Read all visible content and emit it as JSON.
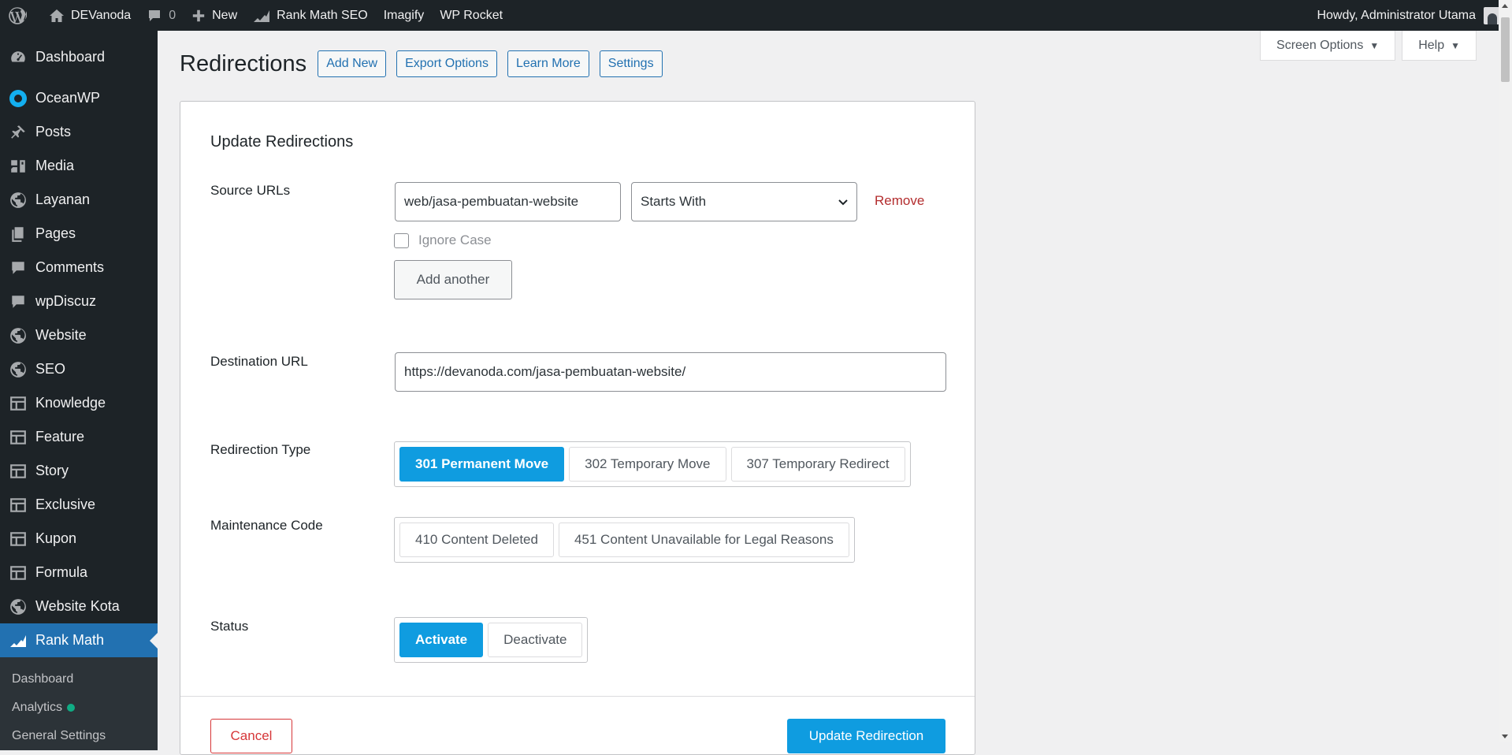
{
  "adminbar": {
    "site_name": "DEVanoda",
    "comments_count": "0",
    "new_label": "New",
    "rankmath_label": "Rank Math SEO",
    "imagify_label": "Imagify",
    "wprocket_label": "WP Rocket",
    "howdy": "Howdy, Administrator Utama"
  },
  "sidebar": {
    "items": [
      {
        "label": "Dashboard",
        "icon": "dashboard-icon"
      },
      {
        "label": "OceanWP",
        "icon": "oceanwp-icon"
      },
      {
        "label": "Posts",
        "icon": "pin-icon"
      },
      {
        "label": "Media",
        "icon": "media-icon"
      },
      {
        "label": "Layanan",
        "icon": "globe-icon"
      },
      {
        "label": "Pages",
        "icon": "pages-icon"
      },
      {
        "label": "Comments",
        "icon": "comment-icon"
      },
      {
        "label": "wpDiscuz",
        "icon": "comment-icon"
      },
      {
        "label": "Website",
        "icon": "globe-icon"
      },
      {
        "label": "SEO",
        "icon": "globe-icon"
      },
      {
        "label": "Knowledge",
        "icon": "table-icon"
      },
      {
        "label": "Feature",
        "icon": "table-icon"
      },
      {
        "label": "Story",
        "icon": "table-icon"
      },
      {
        "label": "Exclusive",
        "icon": "table-icon"
      },
      {
        "label": "Kupon",
        "icon": "table-icon"
      },
      {
        "label": "Formula",
        "icon": "table-icon"
      },
      {
        "label": "Website Kota",
        "icon": "globe-icon"
      },
      {
        "label": "Rank Math",
        "icon": "rankmath-icon"
      }
    ],
    "submenu": [
      "Dashboard",
      "Analytics",
      "General Settings"
    ]
  },
  "screen_meta": {
    "screen_options": "Screen Options",
    "help": "Help"
  },
  "header": {
    "title": "Redirections",
    "actions": [
      "Add New",
      "Export Options",
      "Learn More",
      "Settings"
    ]
  },
  "form": {
    "heading": "Update Redirections",
    "source_label": "Source URLs",
    "source_value": "web/jasa-pembuatan-website",
    "source_match": "Starts With",
    "remove_label": "Remove",
    "ignore_case_label": "Ignore Case",
    "add_another_label": "Add another",
    "destination_label": "Destination URL",
    "destination_value": "https://devanoda.com/jasa-pembuatan-website/",
    "type_label": "Redirection Type",
    "types": [
      "301 Permanent Move",
      "302 Temporary Move",
      "307 Temporary Redirect"
    ],
    "selected_type": "301 Permanent Move",
    "maintenance_label": "Maintenance Code",
    "maintenance_codes": [
      "410 Content Deleted",
      "451 Content Unavailable for Legal Reasons"
    ],
    "status_label": "Status",
    "status_options": [
      "Activate",
      "Deactivate"
    ],
    "selected_status": "Activate",
    "cancel_label": "Cancel",
    "submit_label": "Update Redirection"
  },
  "colors": {
    "admin_dark": "#1d2327",
    "wp_blue": "#2271b1",
    "rankmath_blue": "#0f9ce0",
    "danger": "#b32d2e",
    "analytics_dot": "#10ac84"
  }
}
